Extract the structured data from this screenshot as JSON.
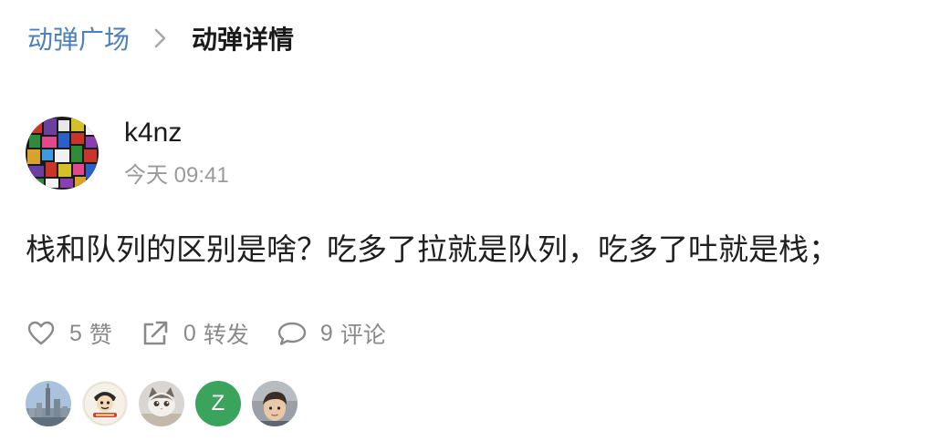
{
  "breadcrumb": {
    "parent": "动弹广场",
    "current": "动弹详情",
    "separator_icon": "chevron-right-icon"
  },
  "post": {
    "author": "k4nz",
    "time": "今天 09:41",
    "content": "栈和队列的区别是啥？吃多了拉就是队列，吃多了吐就是栈；"
  },
  "actions": {
    "like": {
      "icon": "heart-outline-icon",
      "count": "5",
      "label": "赞"
    },
    "forward": {
      "icon": "share-external-icon",
      "count": "0",
      "label": "转发"
    },
    "comment": {
      "icon": "speech-bubble-icon",
      "count": "9",
      "label": "评论"
    }
  },
  "likers": [
    {
      "kind": "city-photo"
    },
    {
      "kind": "cartoon-logo"
    },
    {
      "kind": "cat-photo"
    },
    {
      "kind": "letter",
      "letter": "Z",
      "color": "#3aa45c"
    },
    {
      "kind": "person-photo"
    }
  ],
  "colors": {
    "link": "#4a7fc0",
    "muted": "#9a9a9a",
    "text": "#1f1f1f"
  }
}
